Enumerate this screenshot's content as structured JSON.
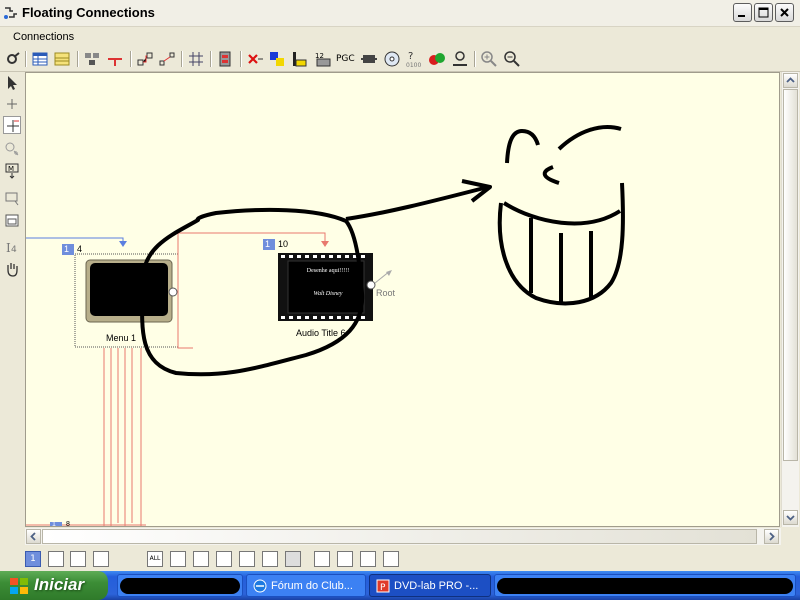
{
  "window": {
    "title": "Floating Connections"
  },
  "menu": {
    "items": [
      "Connections"
    ]
  },
  "toolbar": {
    "pgc_label": "PGC"
  },
  "canvas": {
    "background": "#ffffe6",
    "menu_node": {
      "badge": "1",
      "number": "4",
      "label": "Menu 1"
    },
    "title_node": {
      "badge": "1",
      "number": "10",
      "label": "Audio Title 6",
      "thumb_line1": "Desenhe aqui!!!!!",
      "thumb_line2": "Walt Disney",
      "root_label": "Root"
    },
    "bottom_node": {
      "badge": "1",
      "number": "8"
    }
  },
  "bottombar": {
    "page_number": "1",
    "all_label": "ALL"
  },
  "taskbar": {
    "start_label": "Iniciar",
    "tasks": [
      {
        "label": ""
      },
      {
        "label": "Fórum do Club..."
      },
      {
        "label": "DVD-lab PRO -..."
      },
      {
        "label": ""
      }
    ]
  },
  "colors": {
    "accent": "#245edb",
    "connection": "#e87a6e",
    "incoming": "#5b7fe0",
    "badge": "#6f8edc"
  }
}
